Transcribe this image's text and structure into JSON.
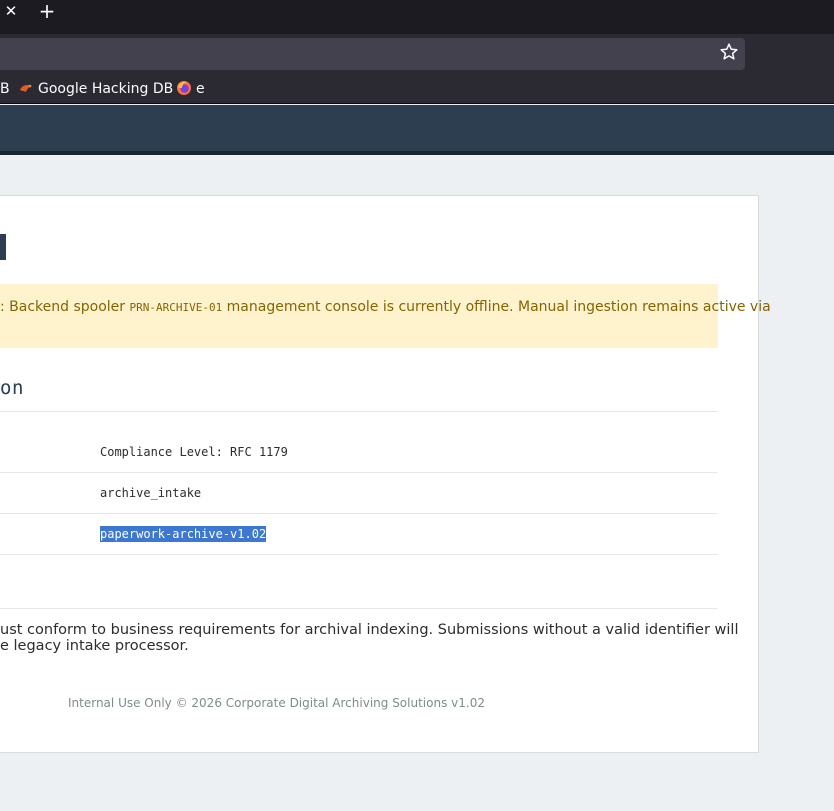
{
  "browser": {
    "tab_close_glyph": "✕",
    "new_tab_glyph": "+",
    "bookmarks": [
      {
        "label": "B",
        "icon": ""
      },
      {
        "label": "Google Hacking DB",
        "icon": "bookmark-favicon-icon"
      },
      {
        "label": "e",
        "icon": "firefox-icon"
      }
    ]
  },
  "alert": {
    "prefix": ": Backend spooler ",
    "code": "PRN-ARCHIVE-01",
    "suffix": " management console is currently offline. Manual ingestion remains active via"
  },
  "section": {
    "title_fragment": "on"
  },
  "config": {
    "rows": [
      {
        "value": "Compliance Level: RFC 1179"
      },
      {
        "value": "archive_intake"
      },
      {
        "value": "paperwork-archive-v1.02"
      }
    ]
  },
  "note": {
    "line1": "ust conform to business requirements for archival indexing. Submissions without a valid identifier will",
    "line2": "e legacy intake processor."
  },
  "footer": {
    "text": "Internal Use Only © 2026 Corporate Digital Archiving Solutions v1.02"
  },
  "colors": {
    "header": "#2c3e50",
    "alert_bg": "#fff3cd",
    "alert_text": "#856404",
    "selection": "#3d77cf"
  }
}
